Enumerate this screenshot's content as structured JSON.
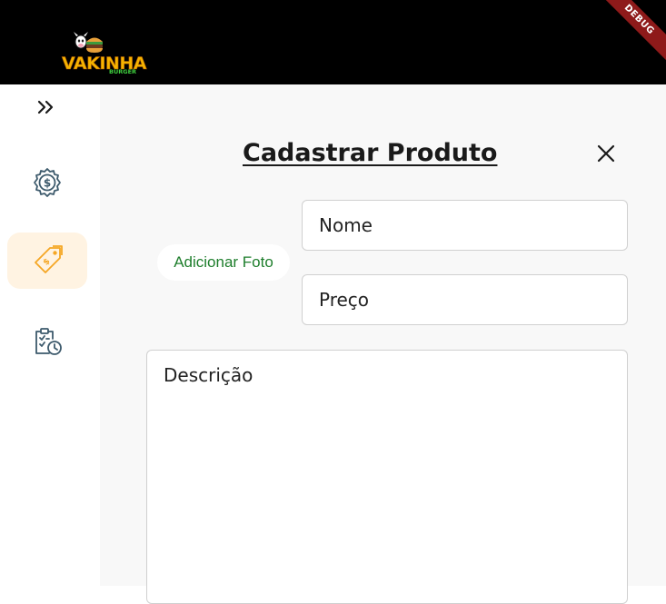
{
  "header": {
    "logo_text": "VAKINHA",
    "logo_subtext": "BURGER",
    "debug_banner": "DEBUG"
  },
  "sidebar": {
    "toggle_icon": "double-chevron-right-icon",
    "items": [
      {
        "icon": "gear-dollar-icon",
        "active": false
      },
      {
        "icon": "price-tag-icon",
        "active": true
      },
      {
        "icon": "order-clipboard-clock-icon",
        "active": false
      }
    ]
  },
  "form": {
    "title": "Cadastrar Produto",
    "add_photo_label": "Adicionar Foto",
    "name_placeholder": "Nome",
    "price_placeholder": "Preço",
    "description_placeholder": "Descrição"
  },
  "colors": {
    "header_bg": "#000000",
    "sidebar_active_bg": "#fff3e2",
    "accent_orange": "#f5a623",
    "icon_slate": "#3d5a6c",
    "link_green": "#1e7e2c",
    "debug_red": "#8e1a1a"
  }
}
